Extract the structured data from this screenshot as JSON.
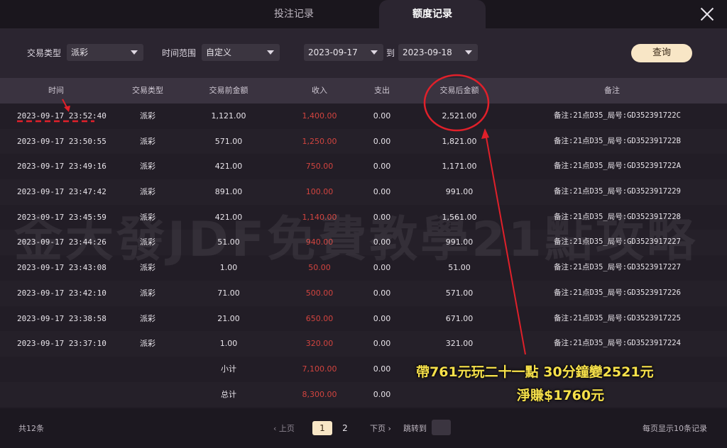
{
  "tabs": [
    {
      "label": "投注记录",
      "active": false
    },
    {
      "label": "额度记录",
      "active": true
    }
  ],
  "filters": {
    "type_label": "交易类型",
    "type_value": "派彩",
    "range_label": "时间范围",
    "range_value": "自定义",
    "date_from": "2023-09-17",
    "to_label": "到",
    "date_to": "2023-09-18",
    "query_label": "查询"
  },
  "columns": [
    "时间",
    "交易类型",
    "交易前金额",
    "收入",
    "支出",
    "交易后金额",
    "备注"
  ],
  "rows": [
    {
      "time": "2023-09-17 23:52:40",
      "type": "派彩",
      "before": "1,121.00",
      "income": "1,400.00",
      "expense": "0.00",
      "after": "2,521.00",
      "note": "备注:21点D35_局号:GD352391722C"
    },
    {
      "time": "2023-09-17 23:50:55",
      "type": "派彩",
      "before": "571.00",
      "income": "1,250.00",
      "expense": "0.00",
      "after": "1,821.00",
      "note": "备注:21点D35_局号:GD352391722B"
    },
    {
      "time": "2023-09-17 23:49:16",
      "type": "派彩",
      "before": "421.00",
      "income": "750.00",
      "expense": "0.00",
      "after": "1,171.00",
      "note": "备注:21点D35_局号:GD352391722A"
    },
    {
      "time": "2023-09-17 23:47:42",
      "type": "派彩",
      "before": "891.00",
      "income": "100.00",
      "expense": "0.00",
      "after": "991.00",
      "note": "备注:21点D35_局号:GD3523917229"
    },
    {
      "time": "2023-09-17 23:45:59",
      "type": "派彩",
      "before": "421.00",
      "income": "1,140.00",
      "expense": "0.00",
      "after": "1,561.00",
      "note": "备注:21点D35_局号:GD3523917228"
    },
    {
      "time": "2023-09-17 23:44:26",
      "type": "派彩",
      "before": "51.00",
      "income": "940.00",
      "expense": "0.00",
      "after": "991.00",
      "note": "备注:21点D35_局号:GD3523917227"
    },
    {
      "time": "2023-09-17 23:43:08",
      "type": "派彩",
      "before": "1.00",
      "income": "50.00",
      "expense": "0.00",
      "after": "51.00",
      "note": "备注:21点D35_局号:GD3523917227"
    },
    {
      "time": "2023-09-17 23:42:10",
      "type": "派彩",
      "before": "71.00",
      "income": "500.00",
      "expense": "0.00",
      "after": "571.00",
      "note": "备注:21点D35_局号:GD3523917226"
    },
    {
      "time": "2023-09-17 23:38:58",
      "type": "派彩",
      "before": "21.00",
      "income": "650.00",
      "expense": "0.00",
      "after": "671.00",
      "note": "备注:21点D35_局号:GD3523917225"
    },
    {
      "time": "2023-09-17 23:37:10",
      "type": "派彩",
      "before": "1.00",
      "income": "320.00",
      "expense": "0.00",
      "after": "321.00",
      "note": "备注:21点D35_局号:GD3523917224"
    }
  ],
  "subtotal": {
    "label": "小计",
    "income": "7,100.00",
    "expense": "0.00"
  },
  "grandtotal": {
    "label": "总计",
    "income": "8,300.00",
    "expense": "0.00"
  },
  "pagination": {
    "total": "共12条",
    "prev": "‹ 上页",
    "pages": [
      "1",
      "2"
    ],
    "current": "1",
    "next": "下页 ›",
    "jump_label": "跳转到",
    "per_page": "每页显示10条记录"
  },
  "watermark": "金大發JDF免費教學21點攻略",
  "annotations": {
    "caption_line1": "帶761元玩二十一點  30分鐘變2521元",
    "caption_line2": "淨賺$1760元",
    "highlight_color": "#e0202a",
    "caption_color": "#f6e04a"
  },
  "colors": {
    "background": "#221d26",
    "income_red": "#d2443f",
    "query_button": "#f8e6c6"
  }
}
